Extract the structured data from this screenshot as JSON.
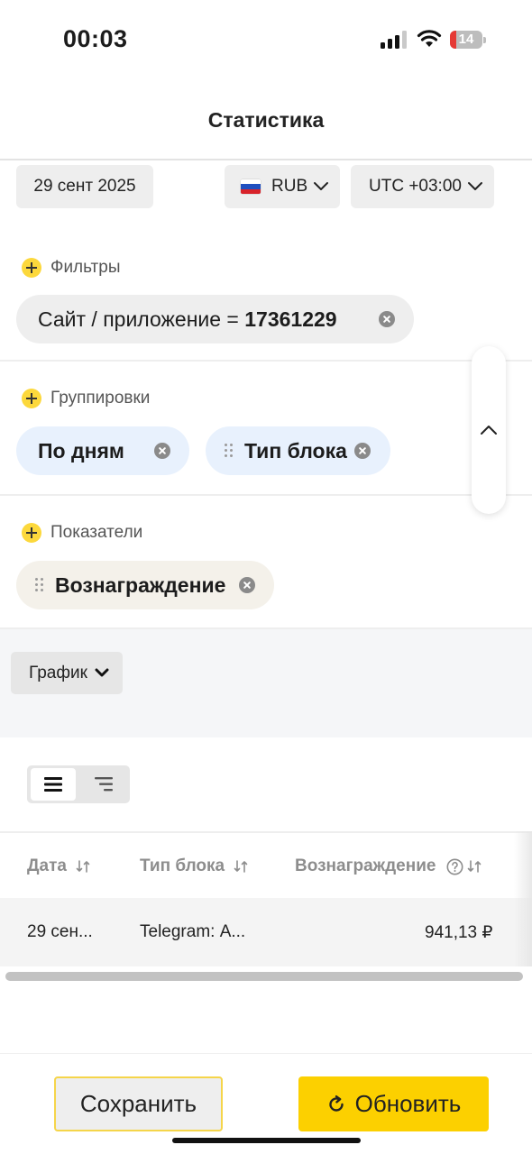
{
  "status_bar": {
    "time": "00:03",
    "battery_level": "14",
    "battery_color": "#e53935"
  },
  "header": {
    "title": "Статистика"
  },
  "selectors": {
    "date": "29 сент 2025",
    "currency": "RUB",
    "currency_flag": "flag-ru-icon",
    "timezone": "UTC +03:00"
  },
  "filters": {
    "label": "Фильтры",
    "items": [
      {
        "prefix": "Сайт / приложение = ",
        "value": "17361229"
      }
    ]
  },
  "groupings": {
    "label": "Группировки",
    "items": [
      {
        "label": "По дням"
      },
      {
        "label": "Тип блока"
      }
    ]
  },
  "metrics": {
    "label": "Показатели",
    "items": [
      {
        "label": "Вознаграждение"
      }
    ]
  },
  "chart_toggle": {
    "label": "График"
  },
  "table": {
    "columns": [
      {
        "label": "Дата"
      },
      {
        "label": "Тип блока"
      },
      {
        "label": "Вознаграждение"
      }
    ],
    "rows": [
      {
        "date": "29 сен...",
        "block_type": "Telegram: А...",
        "reward": "941,13 ₽"
      }
    ]
  },
  "actions": {
    "save_label": "Сохранить",
    "refresh_label": "Обновить"
  },
  "colors": {
    "accent_yellow": "#fcd000",
    "plus_yellow": "#fcd83c",
    "grouping_pill_bg": "#e8f1fd",
    "metric_pill_bg": "#f4f1ea"
  }
}
